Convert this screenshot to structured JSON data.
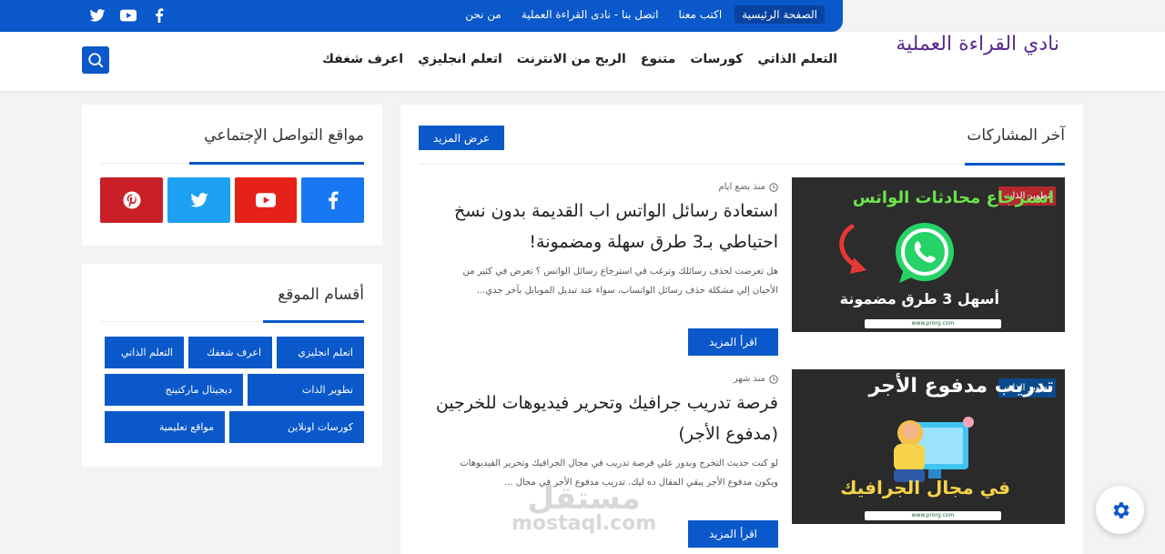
{
  "topbar": {
    "nav": [
      "الصفحة الرئيسية",
      "اكتب معنا",
      "اتصل بنا - نادى القراءة العملية",
      "من نحن"
    ],
    "social": [
      "facebook-icon",
      "youtube-icon",
      "twitter-icon"
    ]
  },
  "header": {
    "site_title": "نادي القراءة العملية",
    "nav": [
      "التعلم الذاتي",
      "كورسات",
      "متنوع",
      "الربح من الانترنت",
      "اتعلم انجليزي",
      "اعرف شغفك"
    ]
  },
  "posts_panel": {
    "title": "آخر المشاركات",
    "more_label": "عرض المزيد",
    "posts": [
      {
        "badge": "تطوير الذات",
        "time": "منذ بضع ايام",
        "title": "استعادة رسائل الواتس اب القديمة بدون نسخ احتياطي بـ3 طرق سهلة ومضمونة!",
        "excerpt": "هل تعرضت لحذف رسائلك وترغب في استرجاع رسائل الواتس ؟ تعرض في كثير من الأحيان إلي مشكلة حذف رسائل الواتساب، سواء عند تبديل الموبايل بآخر جدي...",
        "read_more": "اقرأ المزيد",
        "thumb_line1": "استرجاع محادثات الواتس",
        "thumb_line2": "أسهل 3 طرق مضمونة",
        "thumb_footer": "www.prorg.com"
      },
      {
        "badge": "تطوير الذات",
        "time": "منذ شهر",
        "title": "فرصة تدريب جرافيك وتحرير فيديوهات للخرجين (مدفوع الأجر)",
        "excerpt": "لو كنت حديث التخرج وبدور علي فرصة تدريب في مجال الجرافيك وتحرير الفيديوهات ويكون مدفوع الأجر يبقي المقال ده ليك. تدريب مدفوع الأجر في مجال ...",
        "read_more": "اقرأ المزيد",
        "thumb_line1": "تدريب مدفوع الأجر",
        "thumb_line2": "في مجال الجرافيك",
        "thumb_footer": "www.prorg.com"
      }
    ]
  },
  "social_panel": {
    "title": "مواقع التواصل الإجتماعي",
    "buttons": [
      {
        "icon": "facebook-icon",
        "color": "#1877f2"
      },
      {
        "icon": "youtube-icon",
        "color": "#e62117"
      },
      {
        "icon": "twitter-icon",
        "color": "#1da1f2"
      },
      {
        "icon": "pinterest-icon",
        "color": "#cb1f27"
      }
    ]
  },
  "categories_panel": {
    "title": "أقسام الموقع",
    "items": [
      "اتعلم انجليزي",
      "اعرف شغفك",
      "التعلم الذاتي",
      "تطوير الذات",
      "ديجيتال ماركتينج",
      "كورسات اونلاين",
      "مواقع تعليمية"
    ]
  },
  "watermark": {
    "line1": "مستقل",
    "line2": "mostaql.com"
  },
  "colors": {
    "accent": "#0a58ca",
    "title": "#5b2c8f"
  }
}
